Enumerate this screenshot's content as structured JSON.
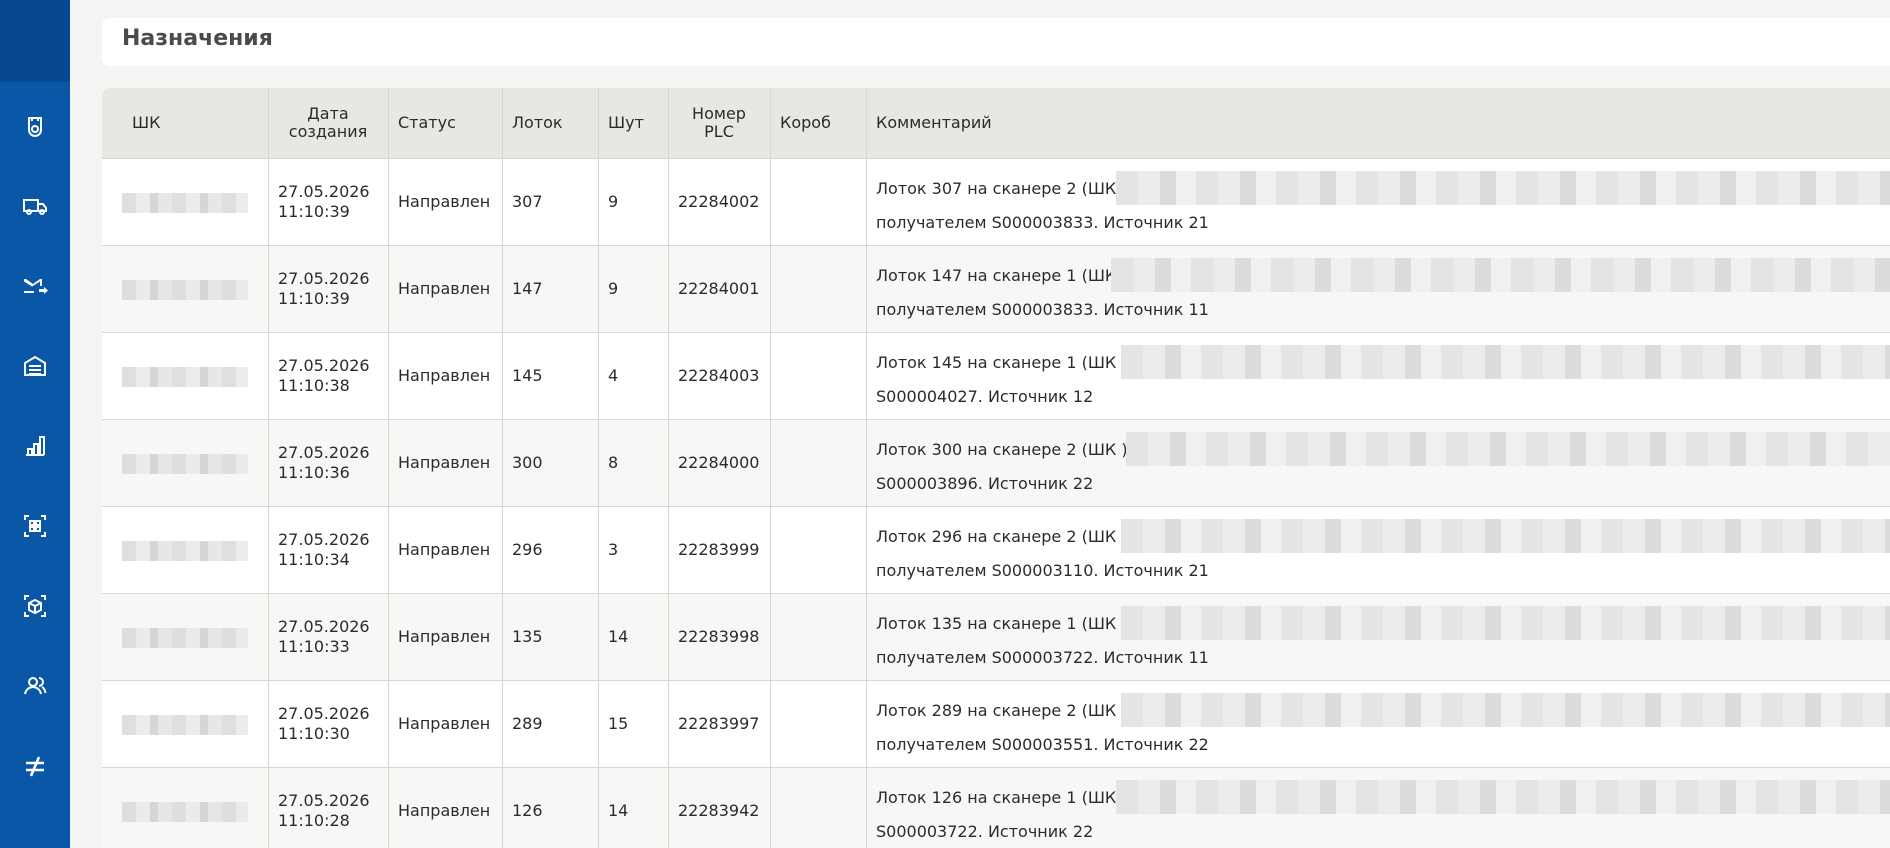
{
  "page_title": "Назначения",
  "sidebar": {
    "items": [
      {
        "icon": "shield-icon"
      },
      {
        "icon": "truck-icon"
      },
      {
        "icon": "mail-forward-icon",
        "active": true
      },
      {
        "icon": "warehouse-icon"
      },
      {
        "icon": "bar-chart-icon"
      },
      {
        "icon": "grid-icon"
      },
      {
        "icon": "box-scan-icon"
      },
      {
        "icon": "users-icon"
      },
      {
        "icon": "not-equal-icon"
      }
    ]
  },
  "table": {
    "headers": {
      "barcode": "ШК",
      "created_1": "Дата",
      "created_2": "создания",
      "status": "Статус",
      "tray": "Лоток",
      "chute": "Шут",
      "plc_1": "Номер",
      "plc_2": "PLC",
      "box": "Короб",
      "comment": "Комментарий"
    },
    "rows": [
      {
        "date": "27.05.2026",
        "time": "11:10:39",
        "status": "Направлен",
        "tray": "307",
        "chute": "9",
        "plc": "22284002",
        "comment_1": "Лоток 307 на сканере 2 (ШК )",
        "comment_2": "получателем S000003833. Источник 21"
      },
      {
        "date": "27.05.2026",
        "time": "11:10:39",
        "status": "Направлен",
        "tray": "147",
        "chute": "9",
        "plc": "22284001",
        "comment_1": "Лоток 147 на сканере 1 (ШК",
        "comment_2": "получателем S000003833. Источник 11"
      },
      {
        "date": "27.05.2026",
        "time": "11:10:38",
        "status": "Направлен",
        "tray": "145",
        "chute": "4",
        "plc": "22284003",
        "comment_1": "Лоток 145 на сканере 1 (ШК )",
        "comment_2": "S000004027. Источник 12"
      },
      {
        "date": "27.05.2026",
        "time": "11:10:36",
        "status": "Направлен",
        "tray": "300",
        "chute": "8",
        "plc": "22284000",
        "comment_1": "Лоток 300 на сканере 2 (ШК )",
        "comment_2": "S000003896. Источник 22"
      },
      {
        "date": "27.05.2026",
        "time": "11:10:34",
        "status": "Направлен",
        "tray": "296",
        "chute": "3",
        "plc": "22283999",
        "comment_1": "Лоток 296 на сканере 2 (ШК )",
        "comment_2": "получателем S000003110. Источник 21"
      },
      {
        "date": "27.05.2026",
        "time": "11:10:33",
        "status": "Направлен",
        "tray": "135",
        "chute": "14",
        "plc": "22283998",
        "comment_1": "Лоток 135 на сканере 1 (ШК )",
        "comment_2": "получателем S000003722. Источник 11"
      },
      {
        "date": "27.05.2026",
        "time": "11:10:30",
        "status": "Направлен",
        "tray": "289",
        "chute": "15",
        "plc": "22283997",
        "comment_1": "Лоток 289 на сканере 2 (ШК )",
        "comment_2": "получателем S000003551. Источник 22"
      },
      {
        "date": "27.05.2026",
        "time": "11:10:28",
        "status": "Направлен",
        "tray": "126",
        "chute": "14",
        "plc": "22283942",
        "comment_1": "Лоток 126 на сканере 1 (ШК )",
        "comment_2": "S000003722. Источник 22"
      }
    ]
  },
  "colors": {
    "sidebar": "#0a57a8",
    "sidebar_top": "#074892",
    "header_bg": "#e8e7e4"
  }
}
